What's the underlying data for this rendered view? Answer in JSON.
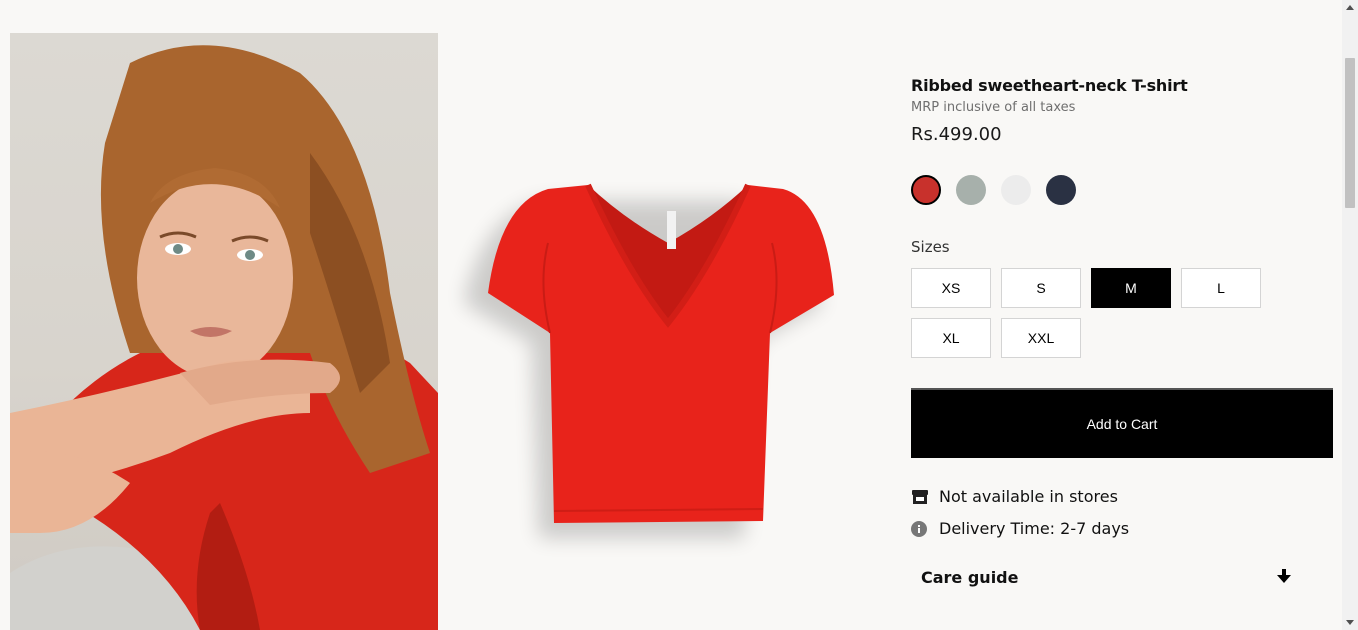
{
  "product": {
    "title": "Ribbed sweetheart-neck T-shirt",
    "mrp_note": "MRP inclusive of all taxes",
    "price": "Rs.499.00"
  },
  "colors": [
    {
      "name": "red",
      "hex": "#c8312c",
      "selected": true
    },
    {
      "name": "sage-grey",
      "hex": "#a7b0ab",
      "selected": false
    },
    {
      "name": "light-grey",
      "hex": "#ececec",
      "selected": false
    },
    {
      "name": "navy",
      "hex": "#2a3143",
      "selected": false
    }
  ],
  "sizes": {
    "label": "Sizes",
    "options": [
      "XS",
      "S",
      "M",
      "L",
      "XL",
      "XXL"
    ],
    "selected": "M"
  },
  "cart": {
    "label": "Add to Cart"
  },
  "availability": {
    "stores_text": "Not available in stores",
    "stores_icon": "store-icon",
    "delivery_text": "Delivery Time: 2-7 days",
    "delivery_icon": "info-icon"
  },
  "care_guide": {
    "label": "Care guide",
    "icon": "arrow-down-icon"
  }
}
